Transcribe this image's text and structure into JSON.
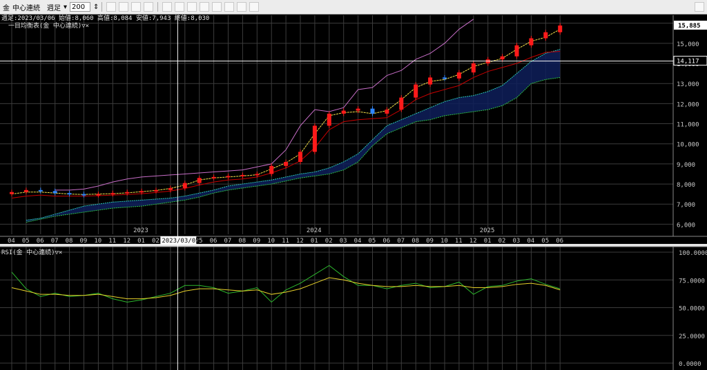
{
  "toolbar": {
    "instrument": "金",
    "contract": "中心連続",
    "period": "週足",
    "bar_count": "200",
    "icons": [
      "cursor-icon",
      "hand-icon",
      "trendline-icon",
      "fibonacci-icon",
      "bar-type-icon",
      "chart-type-icon",
      "candle-icon",
      "ichimoku-icon",
      "volume-icon",
      "settings-icon",
      "zoom-icon",
      "refresh-icon"
    ],
    "pin_icon": "pin-icon"
  },
  "header": {
    "info_line": "週足:2023/03/06 始値:8,060 高値:8,084 安値:7,943 終値:8,030",
    "indicator_label": "一目均衡表(金 中心連続)▽×",
    "rsi_label": "RSI(金 中心連続)▽×"
  },
  "colors": {
    "background": "#000000",
    "grid": "#3c3c3c",
    "up_candle": "#ff1a1a",
    "down_candle": "#2f86ff",
    "tenkan": "#f7e24a",
    "kijun": "#c80000",
    "chikou": "#c86ec8",
    "senkou_a": "#2ac7b6",
    "senkou_b": "#2fc04a",
    "cloud": "#0e1f5a",
    "rsi": "#2db82d",
    "rsi_signal": "#e8d22a"
  },
  "crosshair": {
    "date_label": "2023/03/05",
    "price_label": "14,117"
  },
  "chart_data": {
    "type": "candlestick",
    "instrument": "金 中心連続",
    "timeframe": "週足",
    "price_axis": {
      "ticks": [
        6000,
        7000,
        8000,
        9000,
        10000,
        11000,
        12000,
        13000,
        14000,
        15000,
        16000
      ],
      "tick_labels": [
        "6,000",
        "7,000",
        "8,000",
        "9,000",
        "10,000",
        "11,000",
        "12,000",
        "13,000",
        "14,000",
        "15,000",
        "16,000"
      ],
      "range": [
        5500,
        16400
      ],
      "last_price_label": "15,885"
    },
    "month_labels": [
      "04",
      "05",
      "06",
      "07",
      "08",
      "09",
      "10",
      "11",
      "12",
      "01",
      "02",
      "03",
      "04",
      "05",
      "06",
      "07",
      "08",
      "09",
      "10",
      "11",
      "12",
      "01",
      "02",
      "03",
      "04",
      "05",
      "06",
      "07",
      "08",
      "09",
      "10",
      "11",
      "12",
      "01",
      "02",
      "03",
      "04",
      "05",
      "06"
    ],
    "year_labels": [
      {
        "label": "2023",
        "month_index": 9
      },
      {
        "label": "2024",
        "month_index": 21
      },
      {
        "label": "2025",
        "month_index": 33
      }
    ],
    "closes": {
      "start": "2022/04",
      "resolution": "monthly",
      "values": [
        7600,
        7700,
        7650,
        7550,
        7500,
        7450,
        7500,
        7550,
        7600,
        7650,
        7700,
        7800,
        8050,
        8300,
        8350,
        8400,
        8450,
        8500,
        8900,
        9100,
        9600,
        10900,
        11500,
        11650,
        11750,
        11500,
        11700,
        12300,
        12950,
        13300,
        13250,
        13550,
        14000,
        14200,
        14350,
        14900,
        15250,
        15550,
        15885
      ]
    },
    "ichimoku": {
      "tenkan": [
        7500,
        7600,
        7600,
        7550,
        7500,
        7480,
        7500,
        7520,
        7560,
        7620,
        7680,
        7780,
        7950,
        8200,
        8300,
        8350,
        8400,
        8460,
        8750,
        9050,
        9500,
        10500,
        11400,
        11550,
        11600,
        11500,
        11650,
        12200,
        12800,
        13100,
        13200,
        13450,
        13850,
        14050,
        14250,
        14700,
        15100,
        15300,
        15700
      ],
      "kijun": [
        7300,
        7400,
        7450,
        7400,
        7400,
        7400,
        7420,
        7450,
        7480,
        7520,
        7580,
        7650,
        7780,
        7950,
        8100,
        8200,
        8250,
        8350,
        8550,
        8800,
        9150,
        9800,
        10700,
        11100,
        11200,
        11250,
        11300,
        11700,
        12200,
        12500,
        12700,
        12900,
        13300,
        13600,
        13800,
        14000,
        14300,
        14550,
        14600
      ],
      "chikou": [
        7700,
        7700,
        7750,
        7900,
        8100,
        8250,
        8350,
        8400,
        8450,
        8500,
        8550,
        8600,
        8650,
        8700,
        8850,
        9000,
        9700,
        10900,
        11700,
        11600,
        11800,
        12700,
        12800,
        13400,
        13650,
        14200,
        14500,
        15000,
        15700,
        16200
      ]
    },
    "cloud": {
      "senkou_a": [
        6200,
        6300,
        6500,
        6700,
        6900,
        7000,
        7100,
        7150,
        7200,
        7250,
        7300,
        7400,
        7550,
        7700,
        7900,
        8000,
        8100,
        8200,
        8350,
        8500,
        8600,
        8800,
        9100,
        9500,
        10200,
        10900,
        11200,
        11500,
        11800,
        12100,
        12300,
        12400,
        12600,
        12900,
        13500,
        14100,
        14500,
        14700
      ],
      "senkou_b": [
        6100,
        6250,
        6400,
        6500,
        6600,
        6700,
        6800,
        6850,
        6900,
        7000,
        7100,
        7200,
        7350,
        7550,
        7700,
        7800,
        7900,
        8000,
        8150,
        8300,
        8400,
        8500,
        8700,
        9100,
        9900,
        10500,
        10800,
        11100,
        11200,
        11400,
        11500,
        11600,
        11700,
        11900,
        12300,
        13000,
        13200,
        13300
      ]
    },
    "rsi": {
      "axis_ticks": [
        0,
        25,
        50,
        75,
        100
      ],
      "tick_labels": [
        "0.0000",
        "25.0000",
        "50.0000",
        "75.0000",
        "100.0000"
      ],
      "rsi": [
        82,
        67,
        60,
        63,
        60,
        61,
        63,
        58,
        55,
        57,
        60,
        63,
        70,
        70,
        68,
        63,
        65,
        68,
        55,
        66,
        72,
        80,
        88,
        78,
        70,
        70,
        67,
        70,
        72,
        68,
        69,
        73,
        62,
        69,
        70,
        74,
        76,
        71,
        67
      ],
      "signal": [
        68,
        65,
        62,
        62,
        61,
        61,
        62,
        60,
        58,
        58,
        59,
        61,
        65,
        67,
        67,
        66,
        65,
        66,
        62,
        64,
        67,
        72,
        77,
        75,
        72,
        70,
        69,
        69,
        70,
        69,
        69,
        70,
        68,
        68,
        69,
        71,
        72,
        70,
        66
      ]
    }
  }
}
